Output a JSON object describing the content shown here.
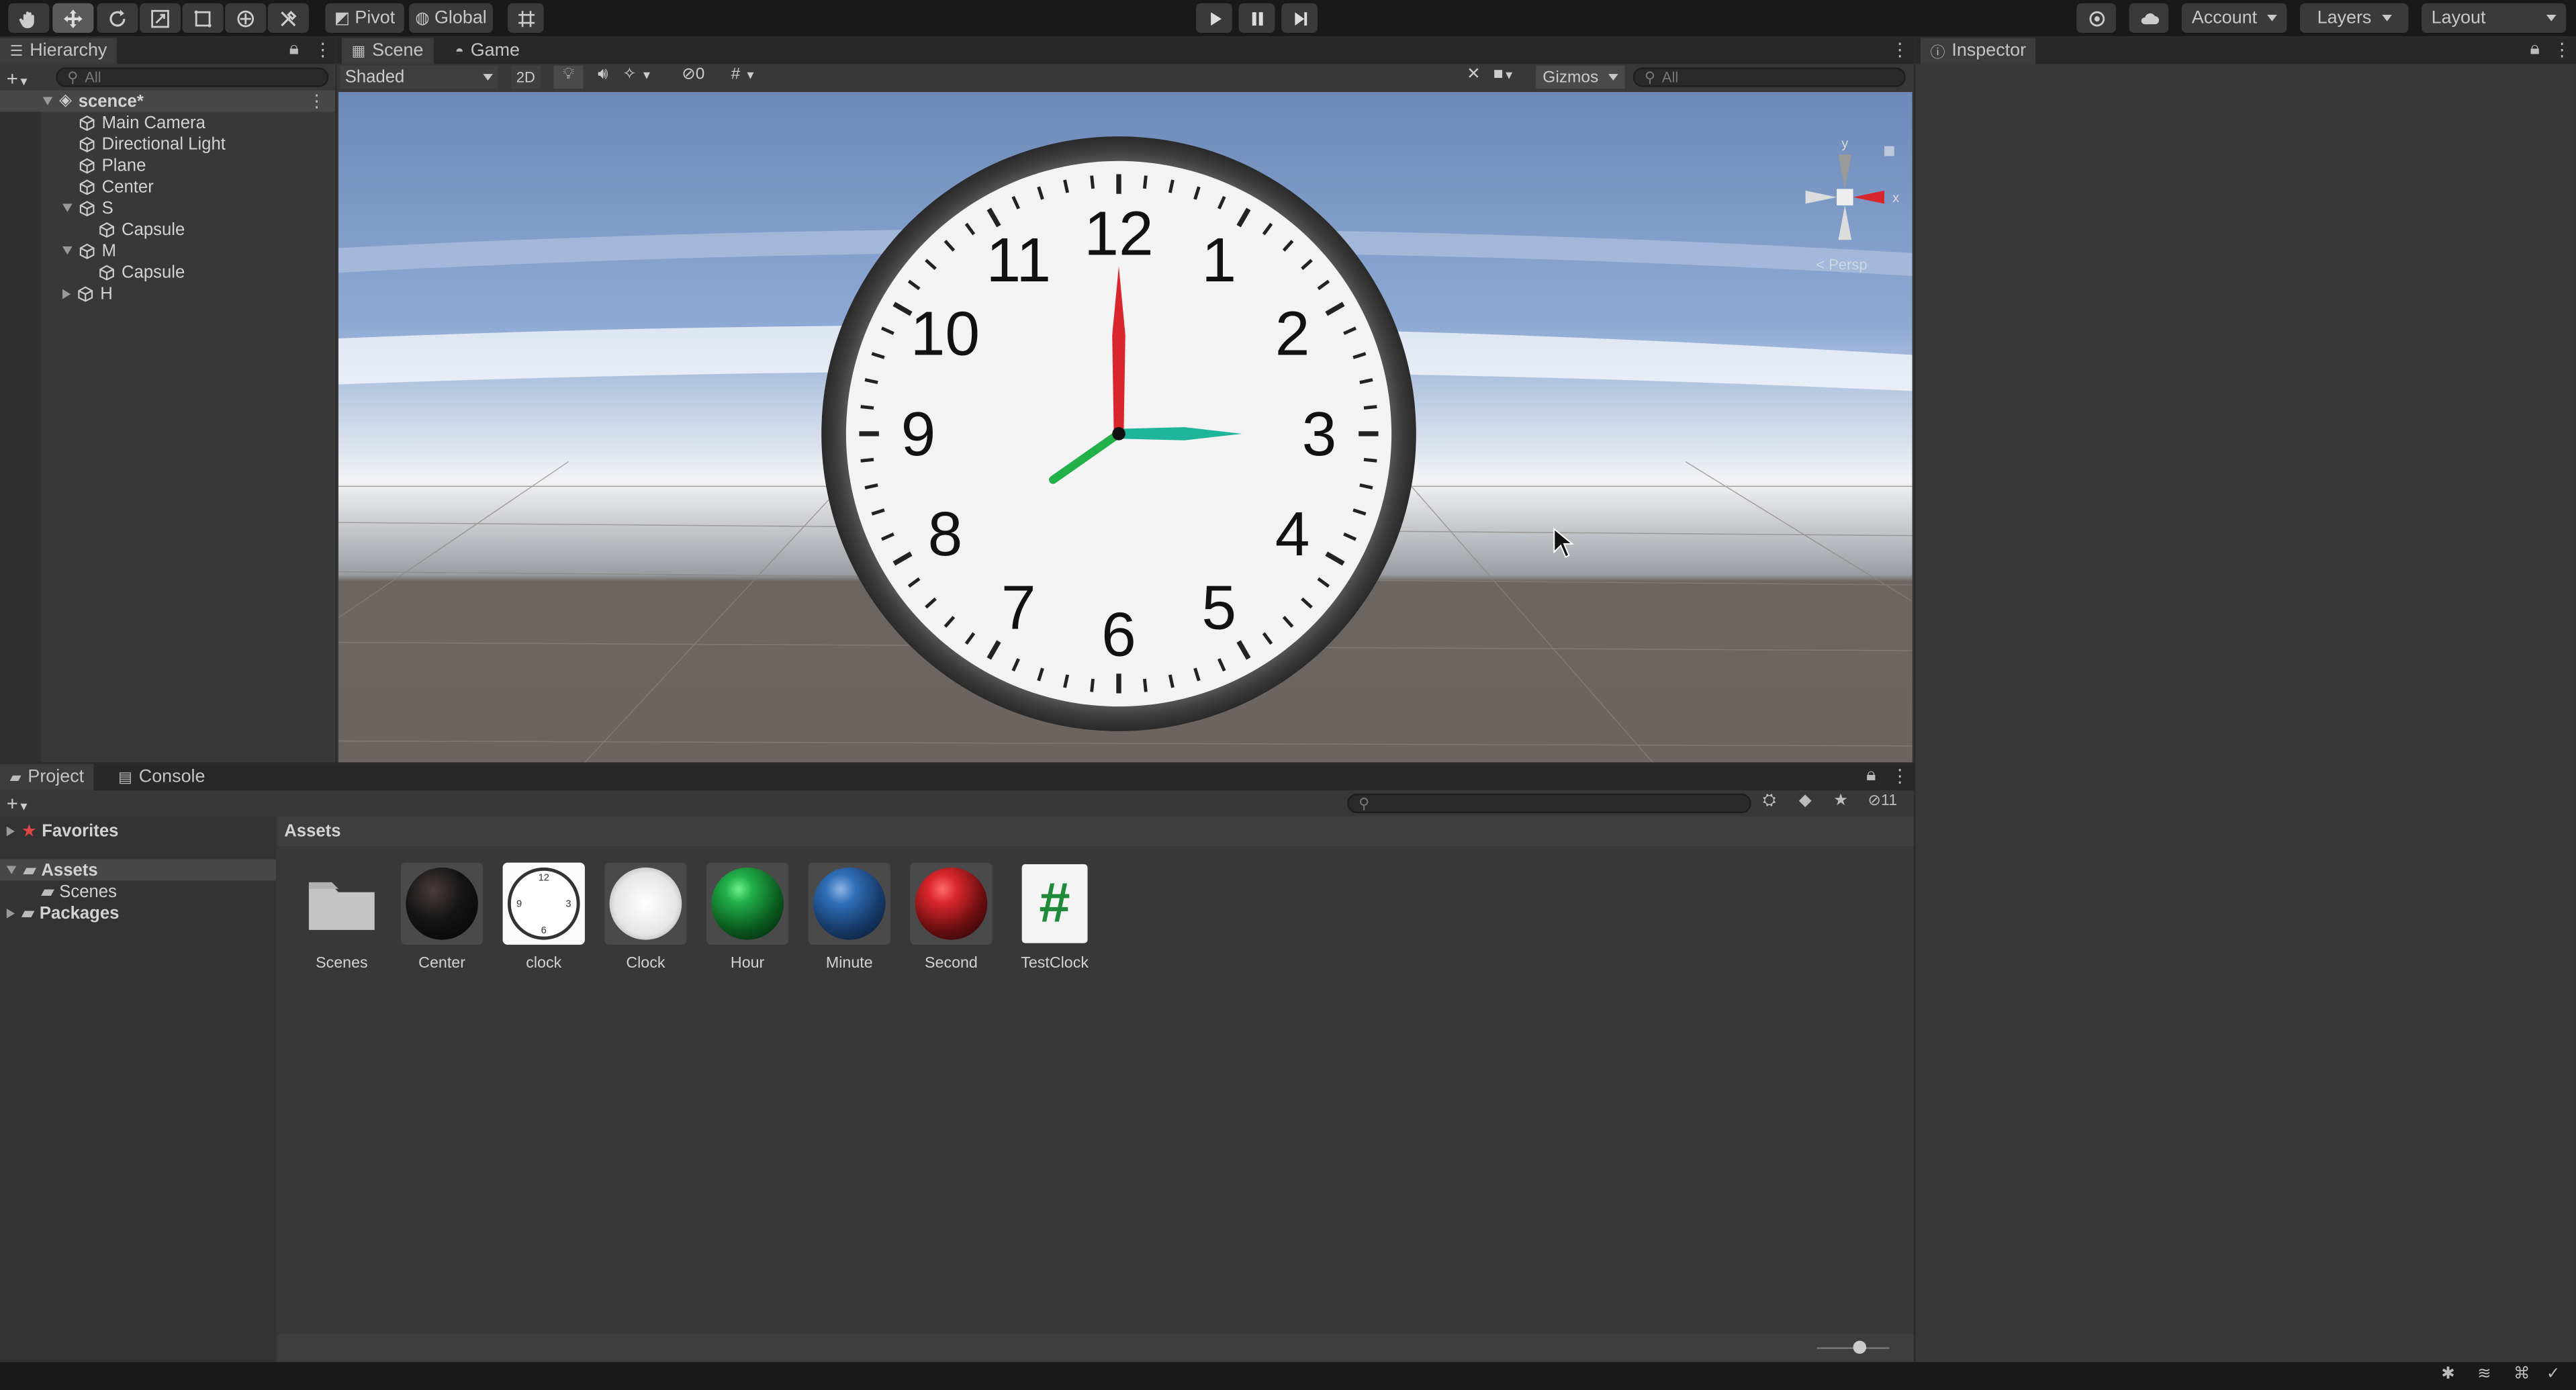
{
  "toolbar": {
    "pivot_label": "Pivot",
    "global_label": "Global",
    "account_label": "Account",
    "layers_label": "Layers",
    "layout_label": "Layout"
  },
  "hierarchy": {
    "tab_label": "Hierarchy",
    "search_placeholder": "All",
    "scene_name": "scence*",
    "items": [
      {
        "label": "Main Camera"
      },
      {
        "label": "Directional Light"
      },
      {
        "label": "Plane"
      },
      {
        "label": "Center"
      },
      {
        "label": "S"
      },
      {
        "label": "Capsule"
      },
      {
        "label": "M"
      },
      {
        "label": "Capsule"
      },
      {
        "label": "H"
      }
    ]
  },
  "scene_view": {
    "tabs": [
      {
        "label": "Scene"
      },
      {
        "label": "Game"
      }
    ],
    "shading_mode": "Shaded",
    "mode_2d": "2D",
    "hidden_count": "0",
    "gizmos_label": "Gizmos",
    "search_placeholder": "All",
    "projection_label": "< Persp",
    "axis_y": "y",
    "axis_x": "x",
    "clock_numbers": [
      "12",
      "1",
      "2",
      "3",
      "4",
      "5",
      "6",
      "7",
      "8",
      "9",
      "10",
      "11"
    ]
  },
  "inspector": {
    "tab_label": "Inspector"
  },
  "project": {
    "tabs": [
      {
        "label": "Project"
      },
      {
        "label": "Console"
      }
    ],
    "favorites_label": "Favorites",
    "assets_label": "Assets",
    "scenes_label": "Scenes",
    "packages_label": "Packages",
    "breadcrumb": "Assets",
    "hidden_count": "11",
    "assets": [
      {
        "name": "Scenes",
        "icon": "folder-icon"
      },
      {
        "name": "Center",
        "icon": "material-sphere-icon",
        "color": "#1a1a1a"
      },
      {
        "name": "clock",
        "icon": "clock-texture-icon"
      },
      {
        "name": "Clock",
        "icon": "clock-material-icon"
      },
      {
        "name": "Hour",
        "icon": "material-sphere-icon",
        "color": "#22b04a"
      },
      {
        "name": "Minute",
        "icon": "material-sphere-icon",
        "color": "#2f6fb8"
      },
      {
        "name": "Second",
        "icon": "material-sphere-icon",
        "color": "#d8262c"
      },
      {
        "name": "TestClock",
        "icon": "csharp-script-icon",
        "glyph": "#"
      }
    ]
  },
  "colors": {
    "toolbar_bg": "#191919",
    "panel_bg": "#383838",
    "second_hand": "#d8262c",
    "minute_hand": "#1fb59a",
    "hour_hand": "#22b04a"
  }
}
